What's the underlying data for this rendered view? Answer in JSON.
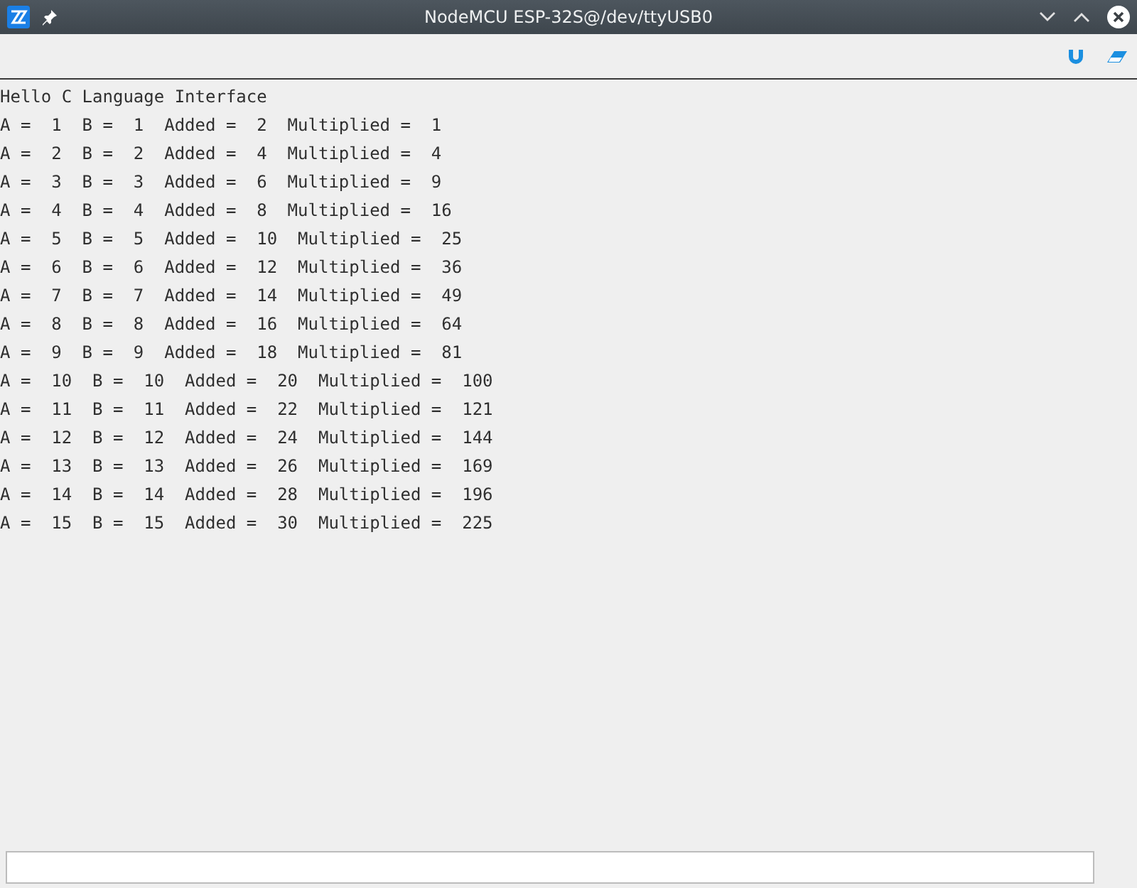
{
  "window": {
    "title": "NodeMCU ESP-32S@/dev/ttyUSB0"
  },
  "output": {
    "lines": [
      "Hello C Language Interface",
      "A =  1  B =  1  Added =  2  Multiplied =  1",
      "A =  2  B =  2  Added =  4  Multiplied =  4",
      "A =  3  B =  3  Added =  6  Multiplied =  9",
      "A =  4  B =  4  Added =  8  Multiplied =  16",
      "A =  5  B =  5  Added =  10  Multiplied =  25",
      "A =  6  B =  6  Added =  12  Multiplied =  36",
      "A =  7  B =  7  Added =  14  Multiplied =  49",
      "A =  8  B =  8  Added =  16  Multiplied =  64",
      "A =  9  B =  9  Added =  18  Multiplied =  81",
      "A =  10  B =  10  Added =  20  Multiplied =  100",
      "A =  11  B =  11  Added =  22  Multiplied =  121",
      "A =  12  B =  12  Added =  24  Multiplied =  144",
      "A =  13  B =  13  Added =  26  Multiplied =  169",
      "A =  14  B =  14  Added =  28  Multiplied =  196",
      "A =  15  B =  15  Added =  30  Multiplied =  225"
    ]
  }
}
